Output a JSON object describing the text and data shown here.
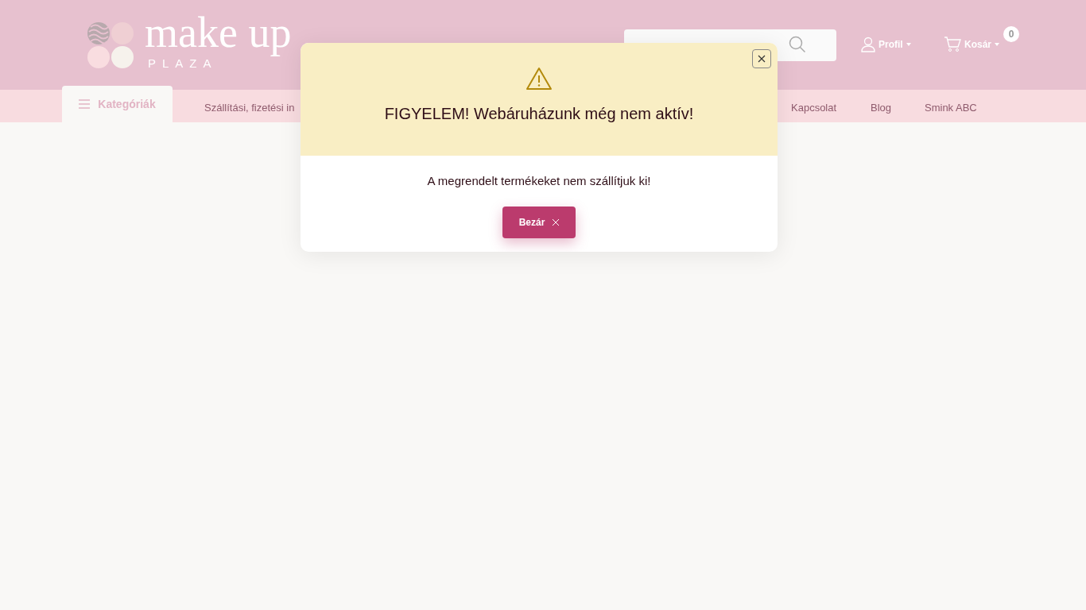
{
  "header": {
    "logo": {
      "title": "make up",
      "subtitle": "PLAZA"
    },
    "profile": "Profil",
    "cart": {
      "label": "Kosár",
      "count": "0"
    }
  },
  "nav": {
    "categories": "Kategóriák",
    "links": [
      "Szállítási, fizetési in",
      "Kapcsolat",
      "Blog",
      "Smink ABC"
    ]
  },
  "modal": {
    "title": "FIGYELEM! Webáruházunk még nem aktív!",
    "message": "A megrendelt termékeket nem szállítjuk ki!",
    "button": "Bezár"
  }
}
